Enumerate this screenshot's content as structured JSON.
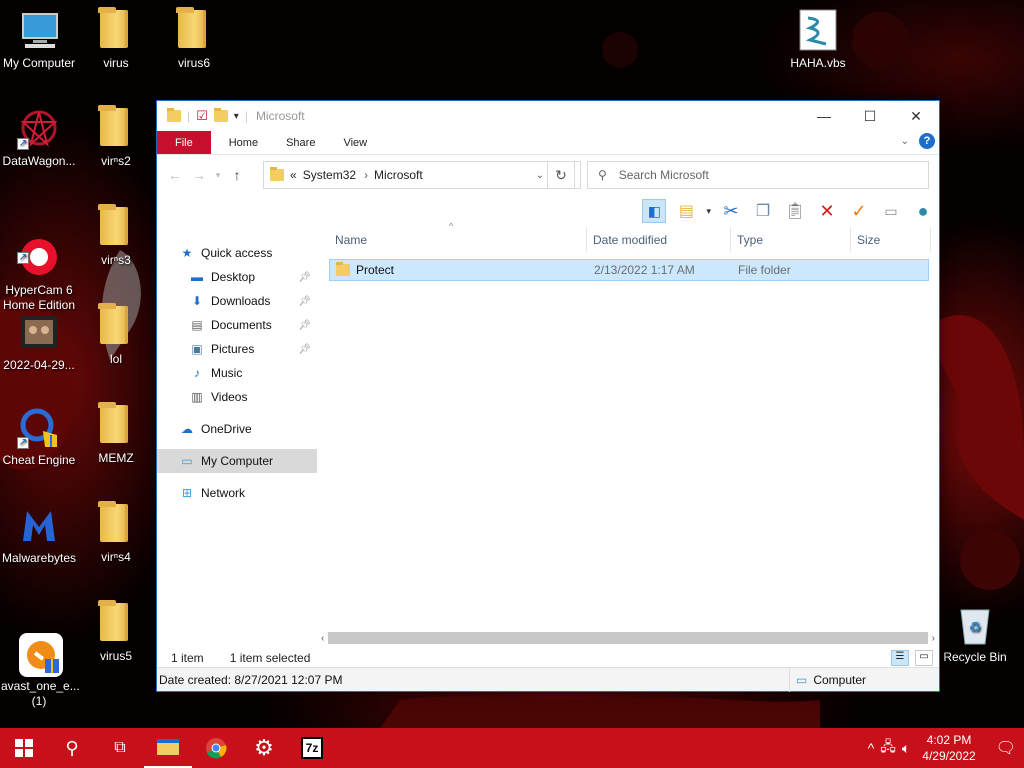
{
  "desktop": {
    "icons_col1": [
      {
        "label": "My Computer",
        "icon": "computer-icon"
      },
      {
        "label": "DataWagon...",
        "icon": "datawagon-icon"
      },
      {
        "label": "HyperCam 6\nHome Edition",
        "icon": "hypercam-icon"
      },
      {
        "label": "2022-04-29...",
        "icon": "video-file-icon"
      },
      {
        "label": "Cheat Engine",
        "icon": "cheat-engine-icon"
      },
      {
        "label": "Malwarebytes",
        "icon": "malwarebytes-icon"
      },
      {
        "label": "avast_one_e...\n(1)",
        "icon": "avast-icon"
      }
    ],
    "icons_col2": [
      {
        "label": "virus"
      },
      {
        "label": "virⁿs2"
      },
      {
        "label": "virⁿs3"
      },
      {
        "label": "lol"
      },
      {
        "label": "MEMZ"
      },
      {
        "label": "virⁿs4"
      },
      {
        "label": "virus5"
      }
    ],
    "icon_virus6": "virus6",
    "icon_haha": "HAHA.vbs",
    "icon_recycle": "Recycle Bin"
  },
  "explorer": {
    "title": "Microsoft",
    "ribbon_tabs": [
      "File",
      "Home",
      "Share",
      "View"
    ],
    "address": {
      "chevron": "«",
      "crumbs": [
        "System32",
        "Microsoft"
      ]
    },
    "search_placeholder": "Search Microsoft",
    "nav": {
      "quick_access": "Quick access",
      "quick_items": [
        "Desktop",
        "Downloads",
        "Documents",
        "Pictures",
        "Music",
        "Videos"
      ],
      "onedrive": "OneDrive",
      "my_computer": "My Computer",
      "network": "Network"
    },
    "columns": {
      "name": "Name",
      "modified": "Date modified",
      "type": "Type",
      "size": "Size"
    },
    "rows": [
      {
        "name": "Protect",
        "modified": "2/13/2022 1:17 AM",
        "type": "File folder"
      }
    ],
    "status": {
      "count": "1 item",
      "selected": "1 item selected"
    },
    "details": {
      "created": "Date created: 8/27/2021 12:07 PM",
      "location": "Computer"
    }
  },
  "taskbar": {
    "time": "4:02 PM",
    "date": "4/29/2022"
  }
}
